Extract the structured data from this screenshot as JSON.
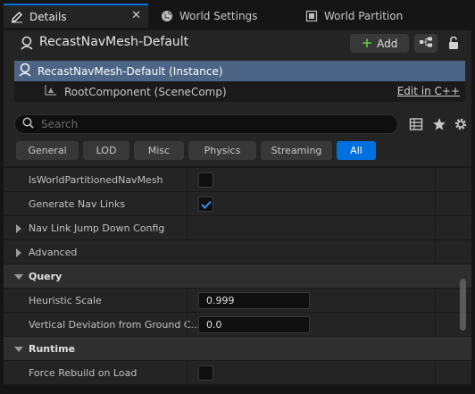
{
  "tabs": [
    {
      "label": "Details",
      "icon": "pencil-icon",
      "active": true
    },
    {
      "label": "World Settings",
      "icon": "globe-icon"
    },
    {
      "label": "World Partition",
      "icon": "grid-icon"
    }
  ],
  "actor": {
    "name": "RecastNavMesh-Default",
    "add_label": "Add"
  },
  "components": [
    {
      "label": "RecastNavMesh-Default (Instance)",
      "selected": true
    },
    {
      "label": "RootComponent (SceneComp)",
      "link": "Edit in C++"
    }
  ],
  "search": {
    "placeholder": "Search"
  },
  "filters": [
    "General",
    "LOD",
    "Misc",
    "Physics",
    "Streaming",
    "All"
  ],
  "active_filter": "All",
  "properties": {
    "is_world_partitioned": {
      "label": "IsWorldPartitionedNavMesh",
      "checked": false
    },
    "generate_nav_links": {
      "label": "Generate Nav Links",
      "checked": true
    },
    "nav_link_jump": {
      "label": "Nav Link Jump Down Config"
    },
    "advanced": {
      "label": "Advanced"
    },
    "query_category": {
      "label": "Query"
    },
    "heuristic_scale": {
      "label": "Heuristic Scale",
      "value": "0.999"
    },
    "vertical_deviation": {
      "label": "Vertical Deviation from Ground C...",
      "value": "0.0"
    },
    "runtime_category": {
      "label": "Runtime"
    },
    "force_rebuild": {
      "label": "Force Rebuild on Load",
      "checked": false
    }
  },
  "colors": {
    "accent": "#0070e0",
    "selection": "#4c6485",
    "panel": "#242424",
    "add_plus": "#59c140"
  }
}
